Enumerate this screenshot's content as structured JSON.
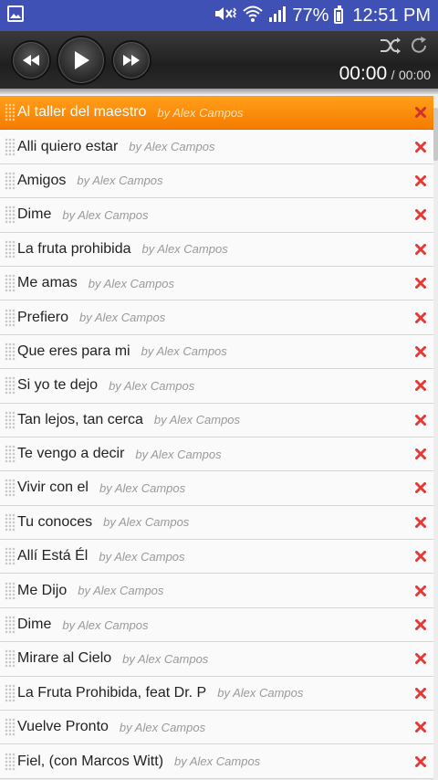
{
  "status_bar": {
    "battery_percent": "77%",
    "time": "12:51 PM",
    "icons": [
      "gallery-icon",
      "mute-vibrate-icon",
      "wifi-icon",
      "signal-icon",
      "battery-icon"
    ]
  },
  "player": {
    "current_time": "00:00",
    "separator": "/",
    "total_time": "00:00",
    "controls": [
      "previous-icon",
      "play-icon",
      "next-icon",
      "shuffle-icon",
      "repeat-icon"
    ]
  },
  "colors": {
    "status_bar": "#3f51b5",
    "active_row": "#f57c00",
    "remove_x": "#e53935"
  },
  "playlist": [
    {
      "title": "Al taller del maestro",
      "artist": "by Alex Campos",
      "active": true
    },
    {
      "title": "Alli quiero estar",
      "artist": "by Alex Campos"
    },
    {
      "title": "Amigos",
      "artist": "by Alex Campos"
    },
    {
      "title": "Dime",
      "artist": "by Alex Campos"
    },
    {
      "title": "La fruta prohibida",
      "artist": "by Alex Campos"
    },
    {
      "title": "Me amas",
      "artist": "by Alex Campos"
    },
    {
      "title": "Prefiero",
      "artist": "by Alex Campos"
    },
    {
      "title": "Que eres para mi",
      "artist": "by Alex Campos"
    },
    {
      "title": "Si yo te dejo",
      "artist": "by Alex Campos"
    },
    {
      "title": "Tan lejos, tan cerca",
      "artist": "by Alex Campos"
    },
    {
      "title": "Te vengo a decir",
      "artist": "by Alex Campos"
    },
    {
      "title": "Vivir con el",
      "artist": "by Alex Campos"
    },
    {
      "title": "Tu conoces",
      "artist": "by Alex Campos"
    },
    {
      "title": "Allí Está Él",
      "artist": "by Alex Campos"
    },
    {
      "title": "Me Dijo",
      "artist": "by Alex Campos"
    },
    {
      "title": "Dime",
      "artist": "by Alex Campos"
    },
    {
      "title": "Mirare al Cielo",
      "artist": "by Alex Campos"
    },
    {
      "title": "La Fruta Prohibida, feat Dr. P",
      "artist": "by Alex Campos"
    },
    {
      "title": "Vuelve Pronto",
      "artist": "by Alex Campos"
    },
    {
      "title": "Fiel, (con Marcos Witt)",
      "artist": "by Alex Campos"
    }
  ]
}
